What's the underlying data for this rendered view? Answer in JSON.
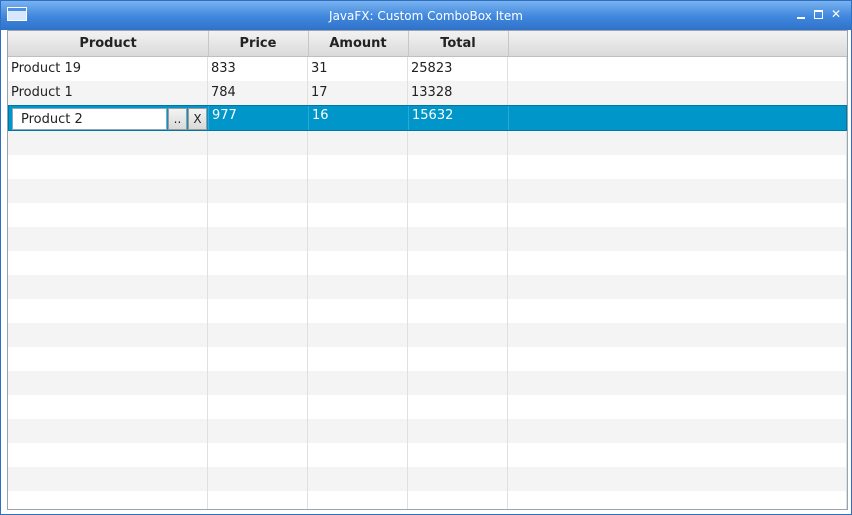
{
  "window": {
    "title": "JavaFX: Custom ComboBox Item",
    "controls": {
      "minimize": "minimize-icon",
      "maximize": "maximize-icon",
      "close": "✕"
    }
  },
  "table": {
    "columns": [
      "Product",
      "Price",
      "Amount",
      "Total"
    ],
    "rows": [
      {
        "product": "Product 19",
        "price": "833",
        "amount": "31",
        "total": "25823"
      },
      {
        "product": "Product 1",
        "price": "784",
        "amount": "17",
        "total": "13328"
      },
      {
        "product": "Product 2",
        "price": "977",
        "amount": "16",
        "total": "15632",
        "selected": true,
        "editing": true
      }
    ],
    "editor": {
      "value": "Product 2",
      "browse_label": "..",
      "clear_label": "X"
    }
  },
  "colors": {
    "selection": "#0096c9",
    "titlebar": "#3f86dd"
  }
}
